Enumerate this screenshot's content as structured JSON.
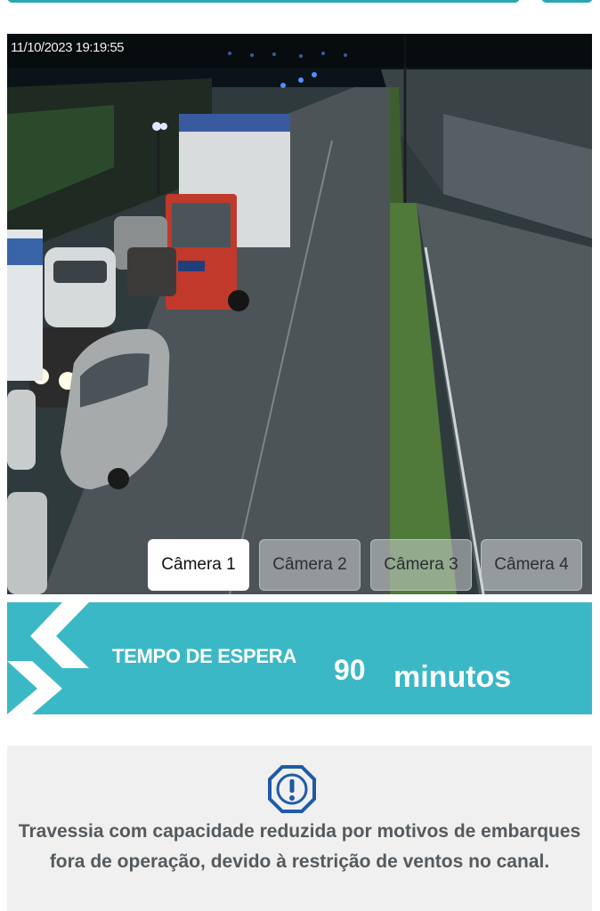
{
  "camera": {
    "timestamp": "11/10/2023 19:19:55",
    "buttons": [
      {
        "label": "Câmera 1",
        "active": true
      },
      {
        "label": "Câmera 2",
        "active": false
      },
      {
        "label": "Câmera 3",
        "active": false
      },
      {
        "label": "Câmera 4",
        "active": false
      }
    ]
  },
  "wait_time": {
    "label": "TEMPO DE ESPERA",
    "value": "90",
    "unit": "minutos"
  },
  "notice": {
    "icon": "alert-octagon-icon",
    "text": "Travessia com capacidade reduzida por motivos de embarques fora de operação, devido à restrição de ventos no canal."
  },
  "colors": {
    "accent": "#3bb8c6",
    "notice_bg": "#f0f0f0",
    "notice_text": "#555a5e",
    "icon_blue": "#1f5aa8"
  }
}
